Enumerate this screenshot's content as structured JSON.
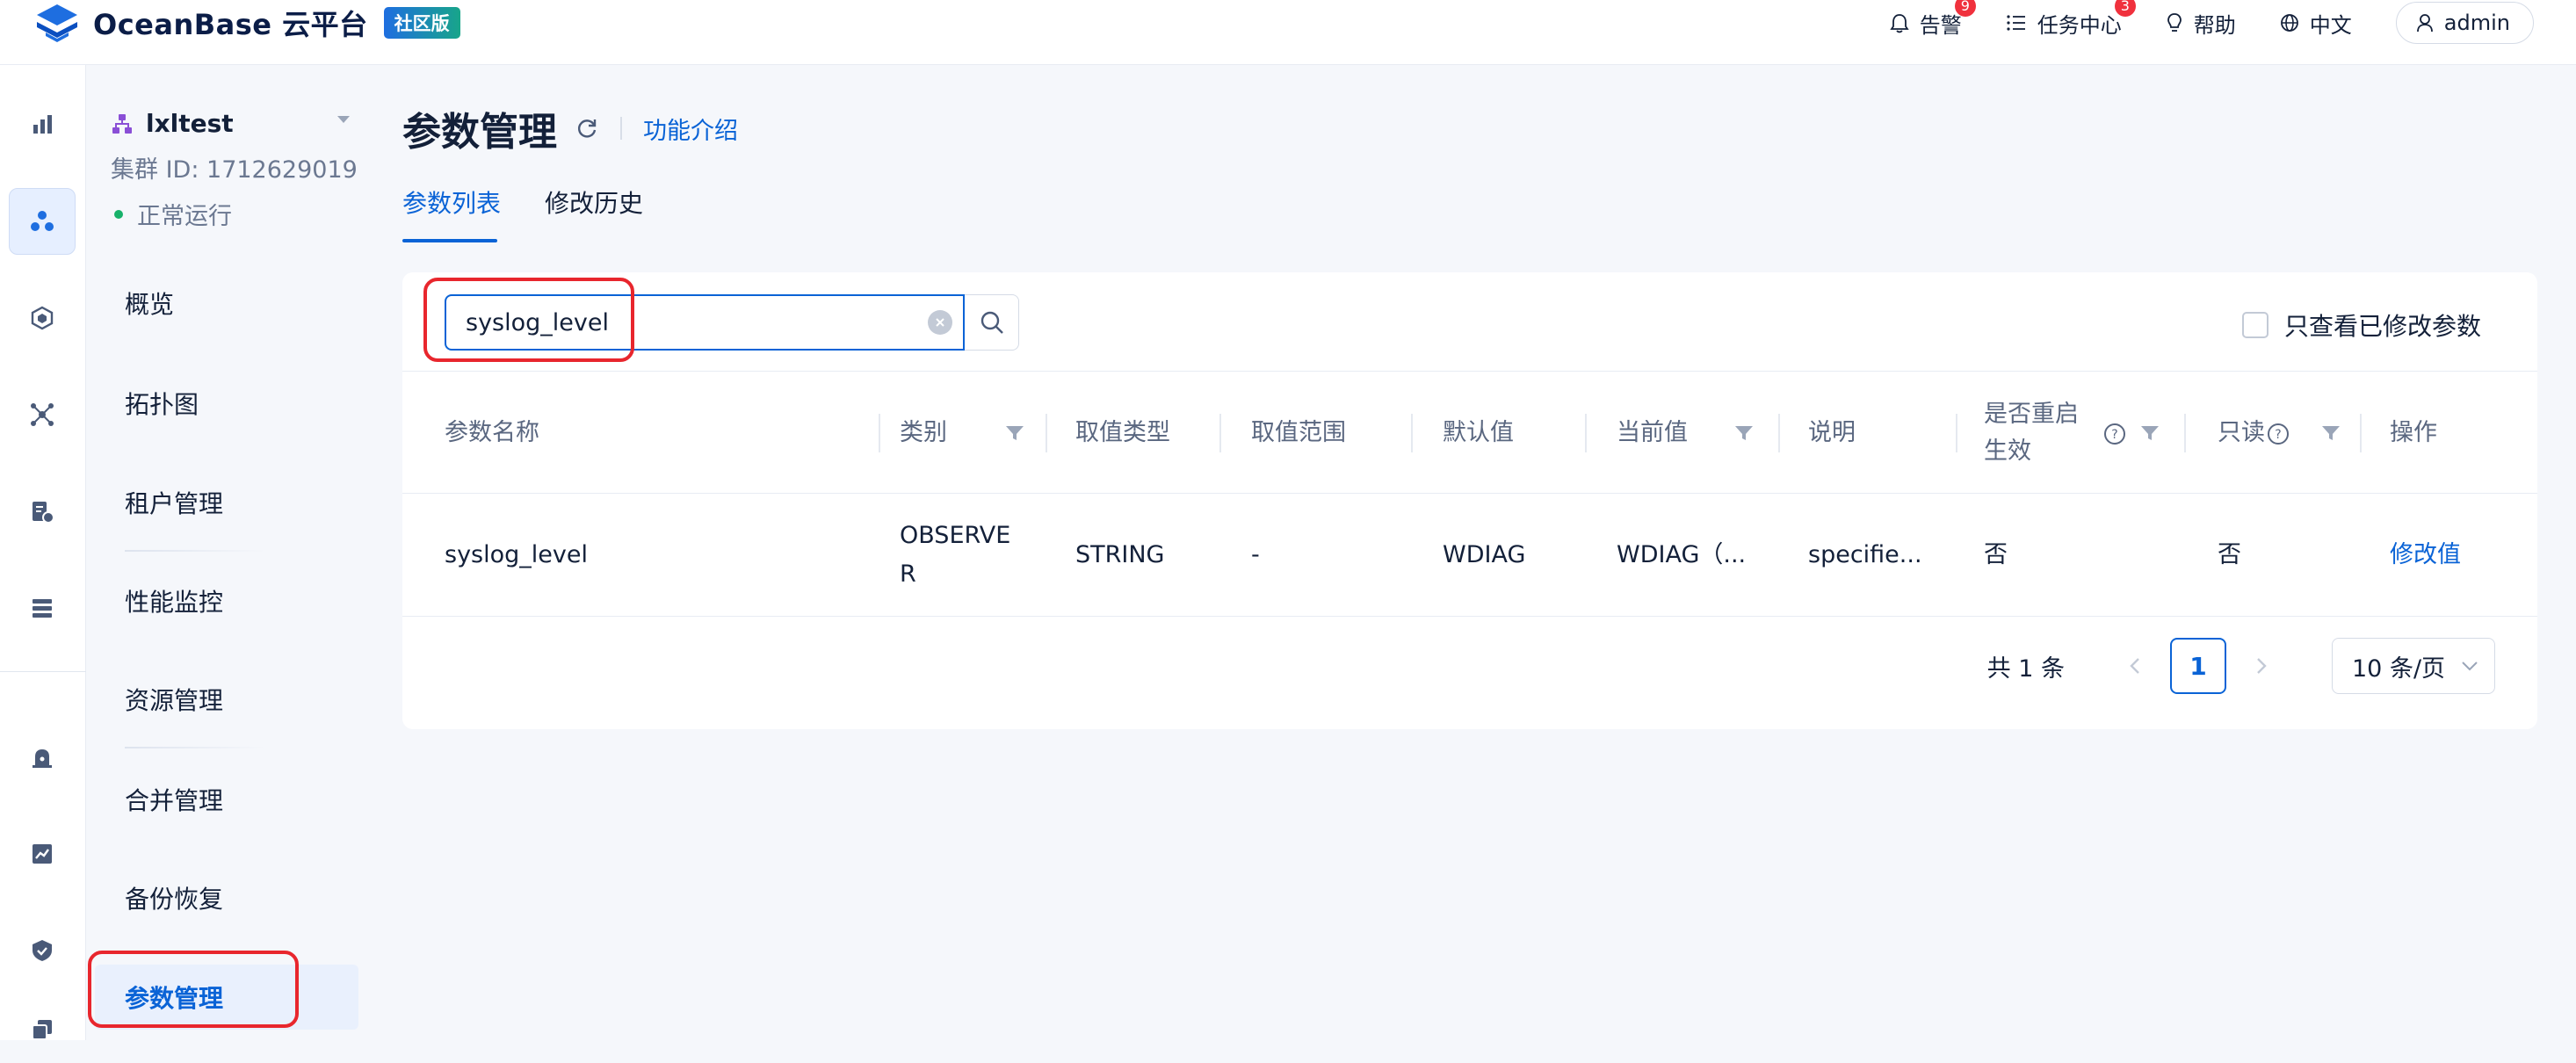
{
  "header": {
    "brand": "OceanBase 云平台",
    "edition_badge": "社区版",
    "alerts_label": "告警",
    "alerts_count": "9",
    "tasks_label": "任务中心",
    "tasks_count": "3",
    "help_label": "帮助",
    "language_label": "中文",
    "user_label": "admin"
  },
  "rail": {
    "icons": [
      "overview-chart-icon",
      "cluster-icon",
      "tenant-cube-icon",
      "topology-icon",
      "package-icon",
      "list-icon",
      "alarm-icon",
      "monitor-chart-icon",
      "security-shield-icon",
      "copy-icon"
    ],
    "active_index": 1
  },
  "cluster": {
    "name": "lxltest",
    "id_label": "集群 ID: 1712629019",
    "status": "正常运行",
    "status_color": "#17b16a"
  },
  "subnav": {
    "items": [
      {
        "label": "概览"
      },
      {
        "label": "拓扑图"
      },
      {
        "label": "租户管理"
      },
      {
        "label": "性能监控"
      },
      {
        "label": "资源管理"
      },
      {
        "label": "合并管理"
      },
      {
        "label": "备份恢复"
      },
      {
        "label": "参数管理"
      }
    ],
    "active_index": 7
  },
  "page": {
    "title": "参数管理",
    "feature_intro": "功能介绍",
    "tabs": [
      {
        "label": "参数列表"
      },
      {
        "label": "修改历史"
      }
    ],
    "active_tab": 0
  },
  "search": {
    "value": "syslog_level",
    "only_modified_label": "只查看已修改参数",
    "only_modified_checked": false
  },
  "table": {
    "columns": [
      {
        "label": "参数名称"
      },
      {
        "label": "类别"
      },
      {
        "label": "取值类型"
      },
      {
        "label": "取值范围"
      },
      {
        "label": "默认值"
      },
      {
        "label": "当前值"
      },
      {
        "label": "说明"
      },
      {
        "label": "是否重启生效"
      },
      {
        "label": "只读"
      },
      {
        "label": "操作"
      }
    ],
    "rows": [
      {
        "name": "syslog_level",
        "category": "OBSERVER",
        "value_type": "STRING",
        "value_range": "-",
        "default_value": "WDIAG",
        "current_value": "WDIAG（...",
        "description": "specifie...",
        "restart_required": "否",
        "read_only": "否",
        "action": "修改值"
      }
    ]
  },
  "pagination": {
    "total": "共 1 条",
    "current_page": "1",
    "page_size": "10 条/页"
  },
  "colors": {
    "accent": "#0a63d6",
    "highlight_box": "#e8262d",
    "badge_alert": "#f0313d"
  }
}
